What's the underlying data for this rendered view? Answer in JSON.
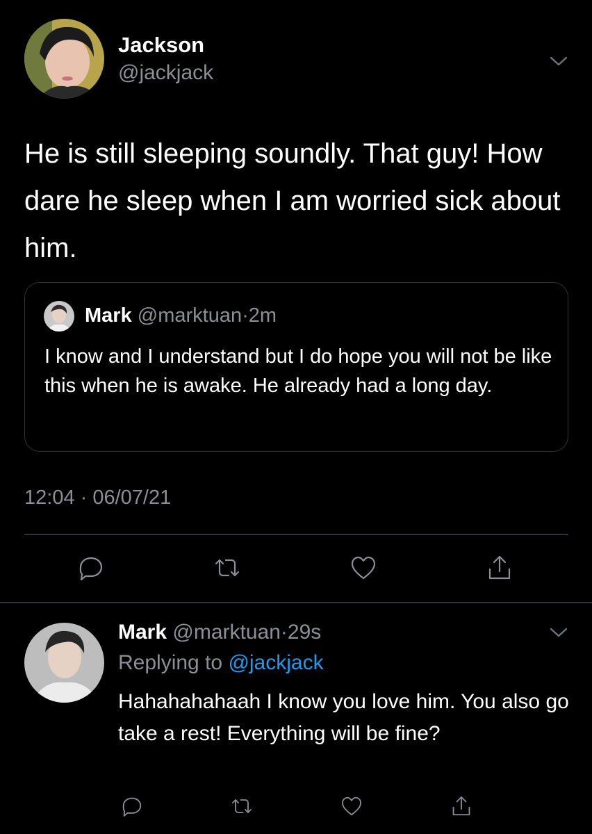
{
  "main_tweet": {
    "name": "Jackson",
    "handle": "@jackjack",
    "text": "He is still sleeping soundly. That guy! How dare he sleep when I am worried sick about him.",
    "timestamp": "12:04 · 06/07/21",
    "quoted": {
      "name": "Mark",
      "handle": "@marktuan",
      "separator": "·",
      "time": "2m",
      "text": "I know and I understand but I do hope you will not be like this when he is awake. He already had a long day."
    },
    "actions": {
      "reply_icon": "reply-icon",
      "retweet_icon": "retweet-icon",
      "like_icon": "heart-icon",
      "share_icon": "share-icon"
    }
  },
  "reply_tweet": {
    "name": "Mark",
    "handle": "@marktuan",
    "separator": "·",
    "time": "29s",
    "replying_to_label": "Replying to",
    "replying_to_handle": "@jackjack",
    "text": "Hahahahahaah I know you love him. You also go take a rest! Everything will be fine?"
  },
  "colors": {
    "background": "#000000",
    "secondary_text": "#8b9096",
    "divider": "#2f3336",
    "link": "#1d9bf0"
  }
}
